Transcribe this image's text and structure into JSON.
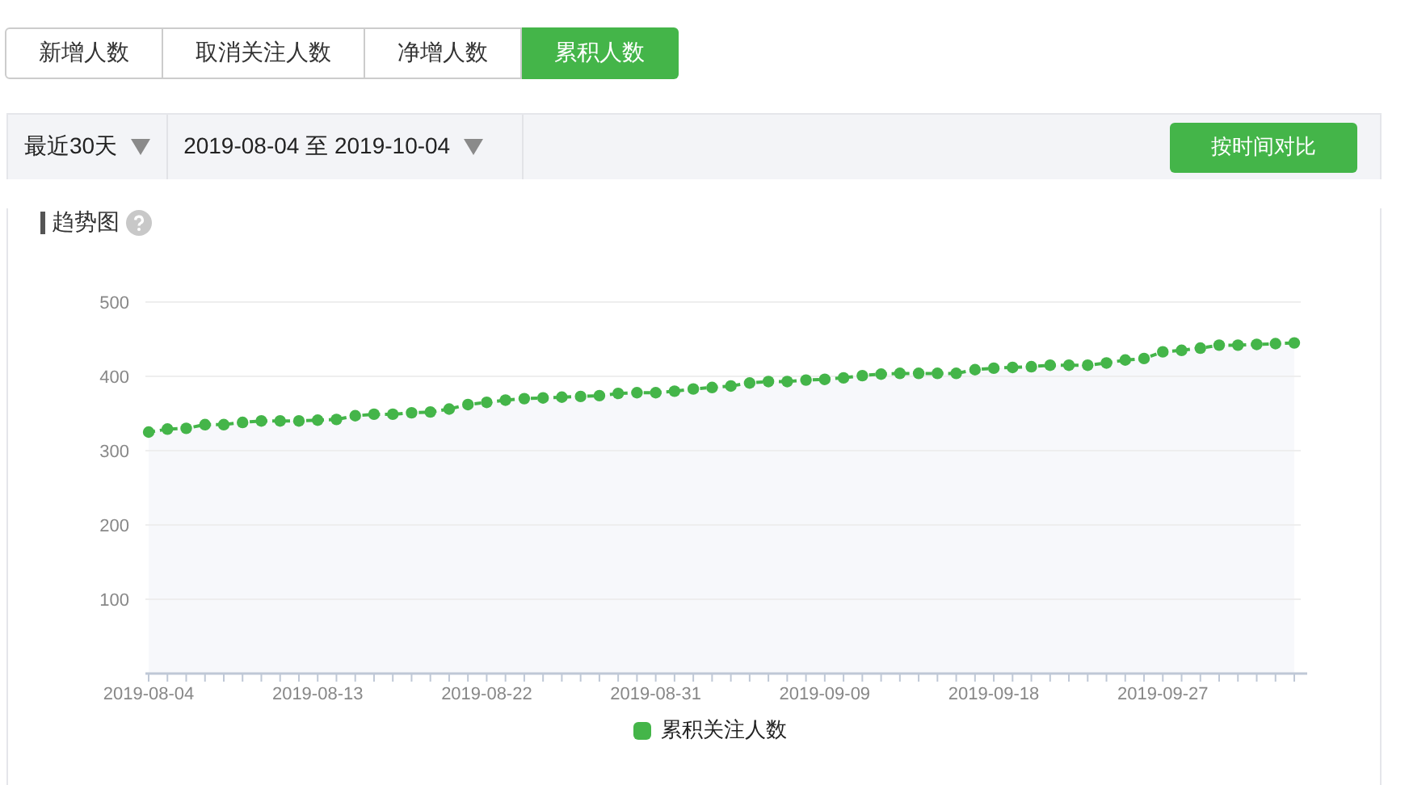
{
  "tabs": [
    {
      "label": "新增人数",
      "selected": false
    },
    {
      "label": "取消关注人数",
      "selected": false
    },
    {
      "label": "净增人数",
      "selected": false
    },
    {
      "label": "累积人数",
      "selected": true
    }
  ],
  "toolbar": {
    "period": "最近30天",
    "date_range": "2019-08-04 至 2019-10-04",
    "compare_button": "按时间对比"
  },
  "trend": {
    "title": "趋势图",
    "chart_data": {
      "type": "area",
      "categories": [
        "2019-08-04",
        null,
        null,
        null,
        null,
        null,
        null,
        null,
        null,
        "2019-08-13",
        null,
        null,
        null,
        null,
        null,
        null,
        null,
        null,
        "2019-08-22",
        null,
        null,
        null,
        null,
        null,
        null,
        null,
        null,
        "2019-08-31",
        null,
        null,
        null,
        null,
        null,
        null,
        null,
        null,
        "2019-09-09",
        null,
        null,
        null,
        null,
        null,
        null,
        null,
        null,
        "2019-09-18",
        null,
        null,
        null,
        null,
        null,
        null,
        null,
        null,
        "2019-09-27",
        null,
        null,
        null,
        null,
        null,
        null,
        null
      ],
      "series": [
        {
          "name": "累积关注人数",
          "color": "#44b549",
          "values": [
            325,
            329,
            330,
            335,
            335,
            338,
            340,
            340,
            340,
            341,
            342,
            347,
            349,
            349,
            351,
            352,
            356,
            362,
            365,
            368,
            370,
            371,
            372,
            373,
            374,
            377,
            378,
            378,
            380,
            383,
            385,
            387,
            391,
            393,
            393,
            395,
            396,
            398,
            401,
            403,
            404,
            404,
            404,
            404,
            409,
            411,
            412,
            413,
            415,
            415,
            415,
            418,
            422,
            424,
            433,
            435,
            438,
            442,
            442,
            443,
            444,
            445
          ]
        }
      ],
      "ylim": [
        0,
        500
      ],
      "grid": true,
      "yticks": [
        100,
        200,
        300,
        400,
        500
      ]
    }
  }
}
